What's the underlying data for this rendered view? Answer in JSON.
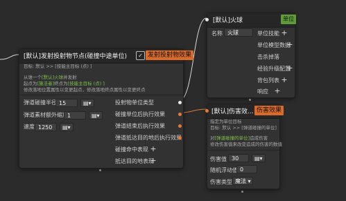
{
  "node_spawn": {
    "title": "[默认]发射投射物节点(碰撞中途单位)",
    "tag": "发射投射物效果",
    "desc_l1": "目标: 默认 >> [技能主目标 (点) ]",
    "desc_l2_a": "从谁一个",
    "desc_l2_b": "[默认]火球",
    "desc_l2_c": "并发射",
    "desc_l3_a": "起点为",
    "desc_l3_b": "[施法者]",
    "desc_l3_c": "终点为",
    "desc_l3_d": "[技能主目标 (点) ]",
    "desc_l4": "修改落地位置属性以变更起点，修改落地终点属性以变更终点",
    "fields": [
      {
        "label": "弹道碰撞半径",
        "value": "15"
      },
      {
        "label": "弹道素材额外缩放",
        "value": "1"
      },
      {
        "label": "速度",
        "value": "1250"
      }
    ],
    "outputs": [
      {
        "label": "投射物单位类型"
      },
      {
        "label": "碰撞单位后执行效果"
      },
      {
        "label": "弹道结束后执行效果"
      },
      {
        "label": "弹道抵达目的地后执行效果"
      },
      {
        "label": "碰撞命中表现"
      },
      {
        "label": "抵达目的地表现"
      }
    ]
  },
  "node_fireball": {
    "title": "[默认]火球",
    "tag": "单位",
    "name_label": "名称",
    "name_value": "火球",
    "rows": [
      "单位技能",
      "单位模型数据",
      "击杀掉落",
      "经验升级配置",
      "背包列表",
      "响应"
    ]
  },
  "node_damage": {
    "title": "[默认]伤害效...",
    "tag": "伤害效果",
    "desc_l1": "指定为单位目标",
    "desc_l2": "目标: 默认 >> [弹道碰撞的单位]",
    "desc_l3_a": "对",
    "desc_l3_b": "[弹道碰撞的单位]",
    "desc_l3_c": "造成伤害",
    "desc_l4": "修改伤害值来改变造成的伤害的数值",
    "fields": [
      {
        "label": "伤害值",
        "value": "30"
      },
      {
        "label": "随机浮动值",
        "value": "0"
      },
      {
        "label": "伤害类型",
        "value": "魔法"
      }
    ]
  },
  "colors": {
    "accent_orange": "#d96a2a",
    "accent_green": "#5f9b3b",
    "link": "#6fa8df",
    "highlight": "#7fc04f"
  }
}
